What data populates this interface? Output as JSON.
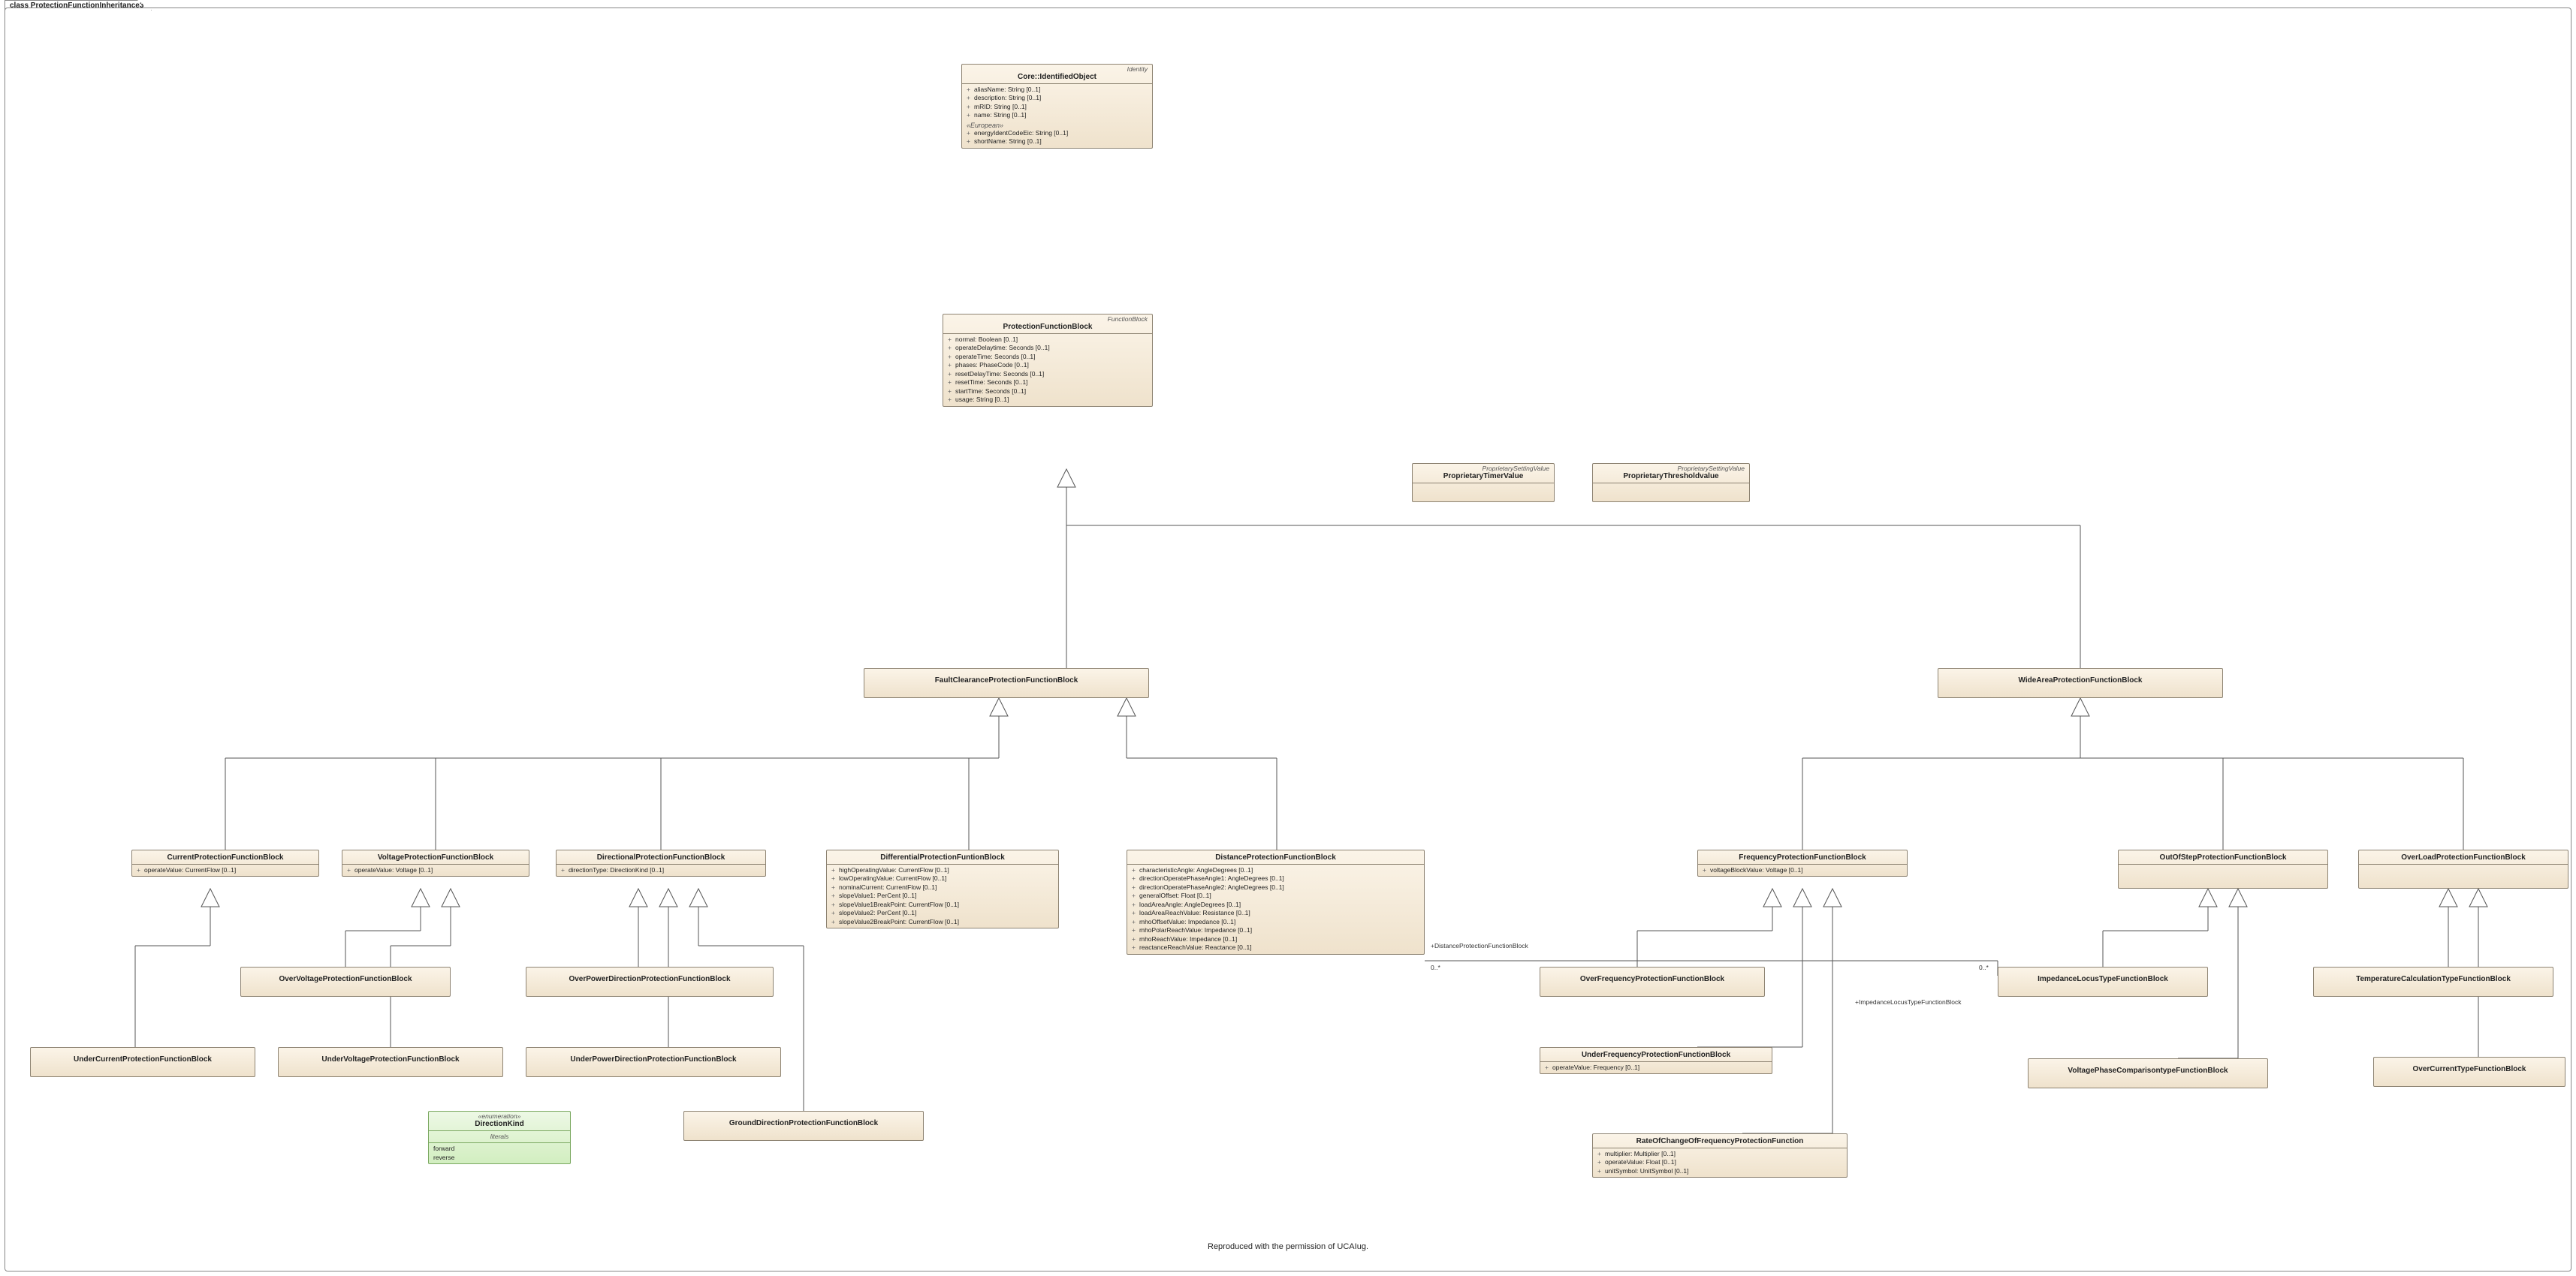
{
  "frame_title": "class ProtectionFunctionInheritance3",
  "footer": "Reproduced with the permission of UCAIug.",
  "identified_object": {
    "stereotype": "Identity",
    "name": "Core::IdentifiedObject",
    "attrs": [
      "aliasName: String [0..1]",
      "description: String [0..1]",
      "mRID: String [0..1]",
      "name: String [0..1]"
    ],
    "group_label": "«European»",
    "group_attrs": [
      "energyIdentCodeEic: String [0..1]",
      "shortName: String [0..1]"
    ]
  },
  "protection_function_block": {
    "stereotype": "FunctionBlock",
    "name": "ProtectionFunctionBlock",
    "attrs": [
      "normal: Boolean [0..1]",
      "operateDelaytime: Seconds [0..1]",
      "operateTime: Seconds [0..1]",
      "phases: PhaseCode [0..1]",
      "resetDelayTime: Seconds [0..1]",
      "resetTime: Seconds [0..1]",
      "startTime: Seconds [0..1]",
      "usage: String [0..1]"
    ]
  },
  "proprietary_timer_value": {
    "stereotype": "ProprietarySettingValue",
    "name": "ProprietaryTimerValue"
  },
  "proprietary_threshold_value": {
    "stereotype": "ProprietarySettingValue",
    "name": "ProprietaryThresholdvalue"
  },
  "fault_clearance": {
    "name": "FaultClearanceProtectionFunctionBlock"
  },
  "wide_area": {
    "name": "WideAreaProtectionFunctionBlock"
  },
  "current_protection": {
    "name": "CurrentProtectionFunctionBlock",
    "attrs": [
      "operateValue: CurrentFlow [0..1]"
    ]
  },
  "voltage_protection": {
    "name": "VoltageProtectionFunctionBlock",
    "attrs": [
      "operateValue: Voltage [0..1]"
    ]
  },
  "directional_protection": {
    "name": "DirectionalProtectionFunctionBlock",
    "attrs": [
      "directionType: DirectionKind [0..1]"
    ]
  },
  "differential_protection": {
    "name": "DifferentialProtectionFuntionBlock",
    "attrs": [
      "highOperatingValue: CurrentFlow [0..1]",
      "lowOperatingValue: CurrentFlow [0..1]",
      "nominalCurrent: CurrentFlow [0..1]",
      "slopeValue1: PerCent [0..1]",
      "slopeValue1BreakPoint: CurrentFlow [0..1]",
      "slopeValue2: PerCent [0..1]",
      "slopeValue2BreakPoint: CurrentFlow [0..1]"
    ]
  },
  "distance_protection": {
    "name": "DistanceProtectionFunctionBlock",
    "attrs": [
      "characteristicAngle: AngleDegrees [0..1]",
      "directionOperatePhaseAngle1: AngleDegrees [0..1]",
      "directionOperatePhaseAngle2: AngleDegrees [0..1]",
      "generalOffset: Float [0..1]",
      "loadAreaAngle: AngleDegrees [0..1]",
      "loadAreaReachValue: Resistance [0..1]",
      "mhoOffsetValue: Impedance [0..1]",
      "mhoPolarReachValue: Impedance [0..1]",
      "mhoReachValue: Impedance [0..1]",
      "reactanceReachValue: Reactance [0..1]"
    ]
  },
  "under_current": {
    "name": "UnderCurrentProtectionFunctionBlock"
  },
  "over_voltage": {
    "name": "OverVoltageProtectionFunctionBlock"
  },
  "under_voltage": {
    "name": "UnderVoltageProtectionFunctionBlock"
  },
  "over_power_dir": {
    "name": "OverPowerDirectionProtectionFunctionBlock"
  },
  "under_power_dir": {
    "name": "UnderPowerDirectionProtectionFunctionBlock"
  },
  "ground_dir": {
    "name": "GroundDirectionProtectionFunctionBlock"
  },
  "direction_kind": {
    "stereotype": "«enumeration»",
    "name": "DirectionKind",
    "section_label": "literals",
    "literals": [
      "forward",
      "reverse"
    ]
  },
  "frequency_protection": {
    "name": "FrequencyProtectionFunctionBlock",
    "attrs": [
      "voltageBlockValue: Voltage [0..1]"
    ]
  },
  "out_of_step": {
    "name": "OutOfStepProtectionFunctionBlock"
  },
  "over_load": {
    "name": "OverLoadProtectionFunctionBlock"
  },
  "over_frequency": {
    "name": "OverFrequencyProtectionFunctionBlock"
  },
  "under_frequency": {
    "name": "UnderFrequencyProtectionFunctionBlock",
    "attrs": [
      "operateValue: Frequency [0..1]"
    ]
  },
  "rate_of_change": {
    "name": "RateOfChangeOfFrequencyProtectionFunction",
    "attrs": [
      "multiplier: Multiplier [0..1]",
      "operateValue: Float [0..1]",
      "unitSymbol: UnitSymbol [0..1]"
    ]
  },
  "impedance_locus": {
    "name": "ImpedanceLocusTypeFunctionBlock"
  },
  "voltage_phase_comparison": {
    "name": "VoltagePhaseComparisontypeFunctionBlock"
  },
  "temperature_calc": {
    "name": "TemperatureCalculationTypeFunctionBlock"
  },
  "over_current_type": {
    "name": "OverCurrentTypeFunctionBlock"
  },
  "assoc_distance": {
    "role": "+DistanceProtectionFunctionBlock",
    "mult": "0..*"
  },
  "assoc_impedance": {
    "role": "+ImpedanceLocusTypeFunctionBlock",
    "mult": "0..*"
  }
}
